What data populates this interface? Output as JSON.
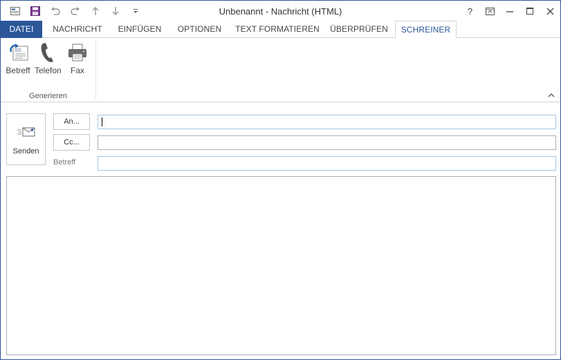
{
  "window": {
    "title": "Unbenannt - Nachricht (HTML)"
  },
  "quick_access": {
    "icons": [
      "mail-app-icon",
      "save-icon",
      "undo-icon",
      "redo-icon",
      "previous-item-icon",
      "next-item-icon",
      "customize-dropdown-icon"
    ]
  },
  "window_controls": {
    "help": "?",
    "ribbon_display": "ribbon-display-options-icon",
    "minimize": "minimize-icon",
    "maximize": "maximize-icon",
    "close": "close-icon"
  },
  "tabs": [
    {
      "label": "DATEI"
    },
    {
      "label": "NACHRICHT"
    },
    {
      "label": "EINFÜGEN"
    },
    {
      "label": "OPTIONEN"
    },
    {
      "label": "TEXT FORMATIEREN"
    },
    {
      "label": "ÜBERPRÜFEN"
    },
    {
      "label": "SCHREINER"
    }
  ],
  "active_tab": "SCHREINER",
  "ribbon": {
    "buttons": [
      {
        "label": "Betreff",
        "icon": "subject-template-icon"
      },
      {
        "label": "Telefon",
        "icon": "phone-icon"
      },
      {
        "label": "Fax",
        "icon": "fax-icon"
      }
    ],
    "group_label": "Generieren"
  },
  "compose": {
    "send_label": "Senden",
    "to_button": "An...",
    "cc_button": "Cc...",
    "subject_label": "Betreff",
    "to_value": "",
    "cc_value": "",
    "subject_value": ""
  },
  "colors": {
    "accent": "#2b579a",
    "active_tab_text": "#2b579a",
    "border": "#abadb3"
  }
}
